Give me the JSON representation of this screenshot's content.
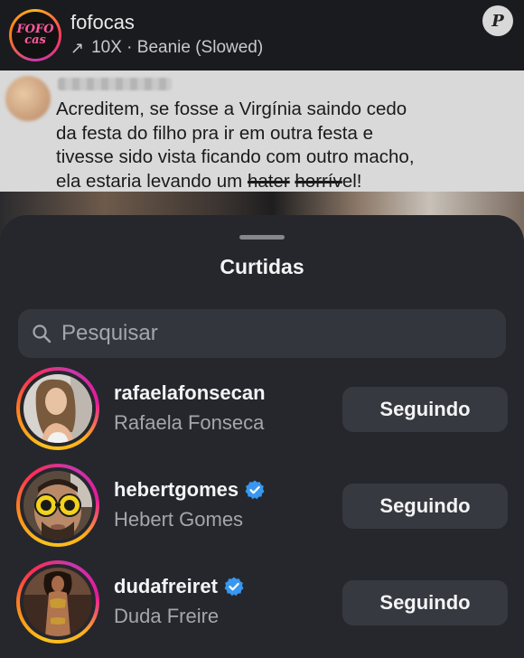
{
  "story": {
    "account_name": "fofocas",
    "logo_text": "FOFO cas",
    "music_prefix": "↗",
    "music_label": "10X · Beanie (Slowed)",
    "pin_badge": "P",
    "tweet": {
      "line1": "Acreditem, se fosse a Virgínia saindo cedo",
      "line2": "da festa do filho pra ir em outra festa e",
      "line3": "tivesse sido vista ficando com outro macho,",
      "line4_start": "ela estaria levando um ",
      "line4_strike1": "hater",
      "line4_mid": " ",
      "line4_strike2": "horrív",
      "line4_end": "el!"
    }
  },
  "sheet": {
    "title": "Curtidas",
    "search": {
      "placeholder": "Pesquisar",
      "value": ""
    }
  },
  "users": [
    {
      "username": "rafaelafonsecan",
      "full_name": "Rafaela Fonseca",
      "verified": false,
      "button_label": "Seguindo"
    },
    {
      "username": "hebertgomes",
      "full_name": "Hebert Gomes",
      "verified": true,
      "button_label": "Seguindo"
    },
    {
      "username": "dudafreiret",
      "full_name": "Duda Freire",
      "verified": true,
      "button_label": "Seguindo"
    }
  ],
  "colors": {
    "sheet_bg": "#25272d",
    "button_bg": "#363940",
    "verified_blue": "#3897f0",
    "secondary_text": "#a4a6ab"
  },
  "icons": [
    "search-icon",
    "verified-badge-icon",
    "music-arrow-icon"
  ]
}
